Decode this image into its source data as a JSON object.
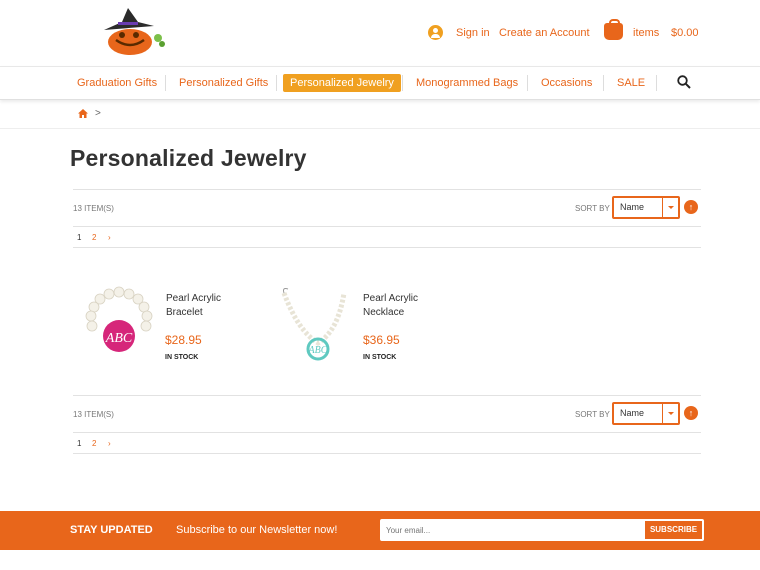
{
  "header": {
    "logo_name": "pumpkin-witch-logo",
    "sign_in": "Sign in",
    "create_account": "Create an Account",
    "cart_label": "items",
    "cart_total": "$0.00"
  },
  "nav": {
    "items": [
      {
        "label": "Graduation Gifts",
        "active": false
      },
      {
        "label": "Personalized Gifts",
        "active": false
      },
      {
        "label": "Personalized Jewelry",
        "active": true
      },
      {
        "label": "Monogrammed Bags",
        "active": false
      },
      {
        "label": "Occasions",
        "active": false
      },
      {
        "label": "SALE",
        "active": false
      }
    ]
  },
  "breadcrumb": {
    "separator": ">"
  },
  "page": {
    "title": "Personalized Jewelry"
  },
  "toolbar": {
    "count": "13 ITEM(S)",
    "sort_by": "SORT BY",
    "sort_value": "Name",
    "sort_dir_icon": "↑",
    "pages": [
      "1",
      "2"
    ],
    "next": "›"
  },
  "products": [
    {
      "name": "Pearl Acrylic Bracelet",
      "price": "$28.95",
      "stock": "IN STOCK",
      "monogram": "ABC",
      "color": "#d6267a"
    },
    {
      "name": "Pearl Acrylic Necklace",
      "price": "$36.95",
      "stock": "IN STOCK",
      "monogram": "ABC",
      "color": "#5fc9c0"
    }
  ],
  "footer": {
    "title": "STAY UPDATED",
    "subtitle": "Subscribe to our Newsletter now!",
    "email_placeholder": "Your email...",
    "subscribe": "SUBSCRIBE"
  },
  "colors": {
    "accent": "#e8661b",
    "active_nav": "#f0a020"
  }
}
